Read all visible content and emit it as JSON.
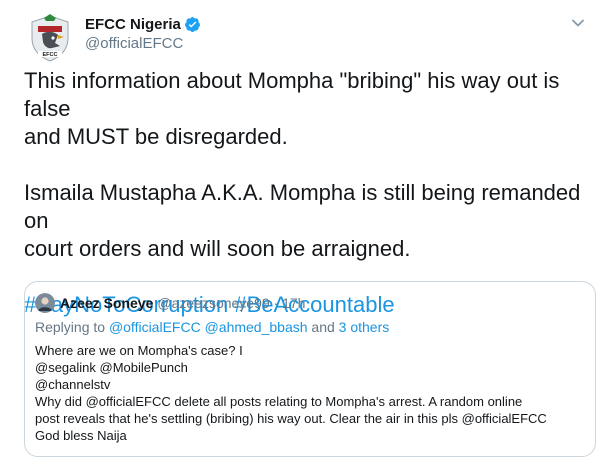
{
  "author": {
    "display_name": "EFCC Nigeria",
    "handle": "@officialEFCC",
    "avatar_text": "EFCC"
  },
  "tweet": {
    "line1": "This information about Mompha \"bribing\" his way out is false",
    "line2": "and MUST be disregarded.",
    "line3": "Ismaila Mustapha A.K.A. Mompha is still being remanded on",
    "line4": "court orders and will soon be arraigned.",
    "hashtag1": "#SayNoToCorruption",
    "hashtag2": "#BeAccountable"
  },
  "quoted": {
    "name": "Azeez Soneye",
    "meta": "@azeezsoneye99 · 17h",
    "reply_prefix": "Replying to",
    "reply_mentions": "@officialEFCC @ahmed_bbash",
    "reply_and": "and",
    "reply_others": "3 others",
    "lines": [
      "Where are we on Mompha's case? I",
      "@segalink @MobilePunch",
      "@channelstv",
      "Why did @officialEFCC delete all posts relating to Mompha's arrest. A random online",
      "post reveals that he's settling (bribing) his way out. Clear the air in this pls @officialEFCC",
      "God bless Naija"
    ]
  },
  "colors": {
    "link": "#1b95e0",
    "muted": "#657786",
    "text": "#14171a",
    "border": "#ccd6dd",
    "verified": "#1da1f2"
  },
  "icons": {
    "verified": "verified-badge-icon",
    "menu": "chevron-down-icon"
  }
}
